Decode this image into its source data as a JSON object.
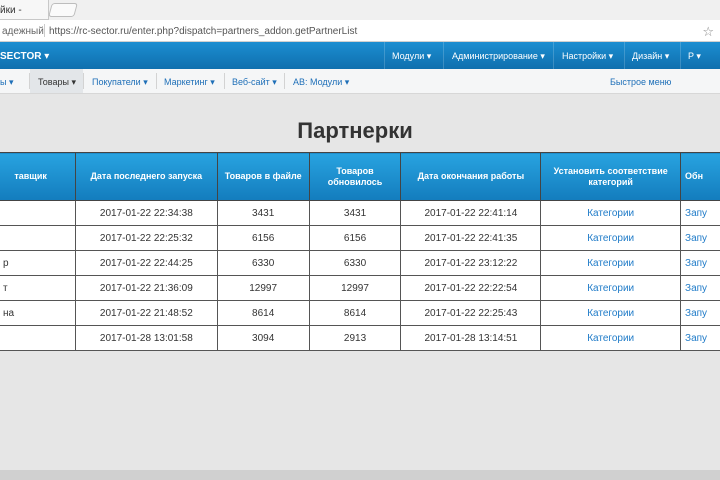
{
  "browser": {
    "tab_title": "йки - ",
    "security_label": "адежный",
    "url": "https://rc-sector.ru/enter.php?dispatch=partners_addon.getPartnerList"
  },
  "topnav": {
    "brand": "SECTOR ▾",
    "items": [
      "Модули ▾",
      "Администрирование ▾",
      "Настройки ▾",
      "Дизайн ▾",
      "P ▾"
    ]
  },
  "subnav": {
    "items": [
      "ы ▾",
      "Товары ▾",
      "Покупатели ▾",
      "Маркетинг ▾",
      "Веб-сайт ▾",
      "AB: Модули ▾"
    ],
    "quick_menu": "Быстрое меню"
  },
  "page": {
    "title": "Партнерки"
  },
  "table": {
    "headers": [
      "тавщик",
      "Дата последнего запуска",
      "Товаров в файле",
      "Товаров обновилось",
      "Дата окончания работы",
      "Установить соответствие категорий",
      "Обн"
    ],
    "rows": [
      [
        "",
        "2017-01-22 22:34:38",
        "3431",
        "3431",
        "2017-01-22 22:41:14",
        "Категории",
        "Запу"
      ],
      [
        "",
        "2017-01-22 22:25:32",
        "6156",
        "6156",
        "2017-01-22 22:41:35",
        "Категории",
        "Запу"
      ],
      [
        "р",
        "2017-01-22 22:44:25",
        "6330",
        "6330",
        "2017-01-22 23:12:22",
        "Категории",
        "Запу"
      ],
      [
        "т",
        "2017-01-22 21:36:09",
        "12997",
        "12997",
        "2017-01-22 22:22:54",
        "Категории",
        "Запу"
      ],
      [
        "на",
        "2017-01-22 21:48:52",
        "8614",
        "8614",
        "2017-01-22 22:25:43",
        "Категории",
        "Запу"
      ],
      [
        "",
        "2017-01-28 13:01:58",
        "3094",
        "2913",
        "2017-01-28 13:14:51",
        "Категории",
        "Запу"
      ]
    ]
  }
}
